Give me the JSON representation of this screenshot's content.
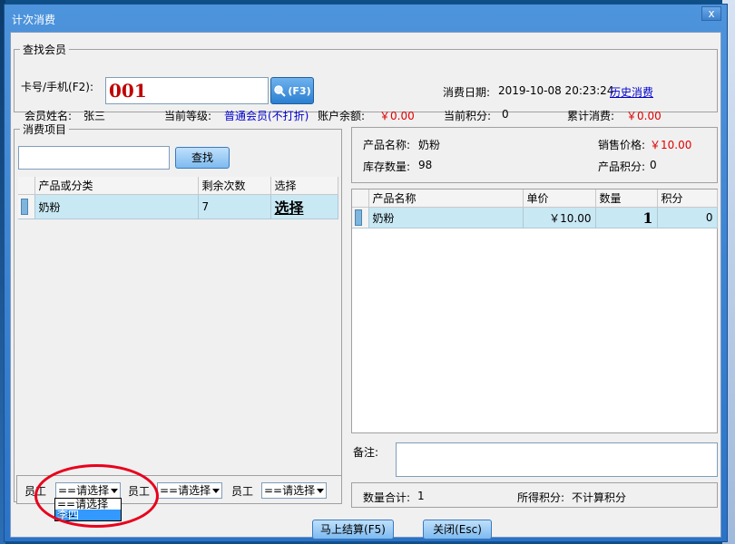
{
  "window": {
    "title": "计次消费",
    "close_label": "x"
  },
  "member_search": {
    "legend": "查找会员",
    "card_label": "卡号/手机(F2):",
    "card_value": "001",
    "search_button": "(F3)",
    "date_label": "消费日期:",
    "date_value": "2019-10-08 20:23:24",
    "history_link": "历史消费",
    "name_label": "会员姓名:",
    "name_value": "张三",
    "level_label": "当前等级:",
    "level_value": "普通会员(不打折)",
    "balance_label": "账户余额:",
    "balance_value": "￥0.00",
    "points_label": "当前积分:",
    "points_value": "0",
    "total_label": "累计消费:",
    "total_value": "￥0.00"
  },
  "items_panel": {
    "legend": "消费项目",
    "search_button": "查找",
    "columns": [
      "产品或分类",
      "剩余次数",
      "选择"
    ],
    "rows": [
      {
        "name": "奶粉",
        "remaining": "7",
        "select": "选择"
      }
    ]
  },
  "product_info": {
    "name_label": "产品名称:",
    "name_value": "奶粉",
    "price_label": "销售价格:",
    "price_value": "￥10.00",
    "stock_label": "库存数量:",
    "stock_value": "98",
    "points_label": "产品积分:",
    "points_value": "0"
  },
  "cart": {
    "columns": [
      "产品名称",
      "单价",
      "数量",
      "积分"
    ],
    "rows": [
      {
        "name": "奶粉",
        "price": "￥10.00",
        "qty": "1",
        "points": "0"
      }
    ]
  },
  "remark": {
    "label": "备注:"
  },
  "summary": {
    "qty_label": "数量合计:",
    "qty_value": "1",
    "points_label": "所得积分:",
    "points_value": "不计算积分"
  },
  "staff": {
    "label": "员工",
    "placeholder": "==请选择",
    "dropdown_options": [
      "==请选择==",
      "李四"
    ]
  },
  "footer": {
    "checkout_button": "马上结算(F5)",
    "close_button": "关闭(Esc)"
  },
  "colors": {
    "accent_red": "#e00000",
    "link_blue": "#0000cc",
    "annotation": "#e8001c"
  }
}
